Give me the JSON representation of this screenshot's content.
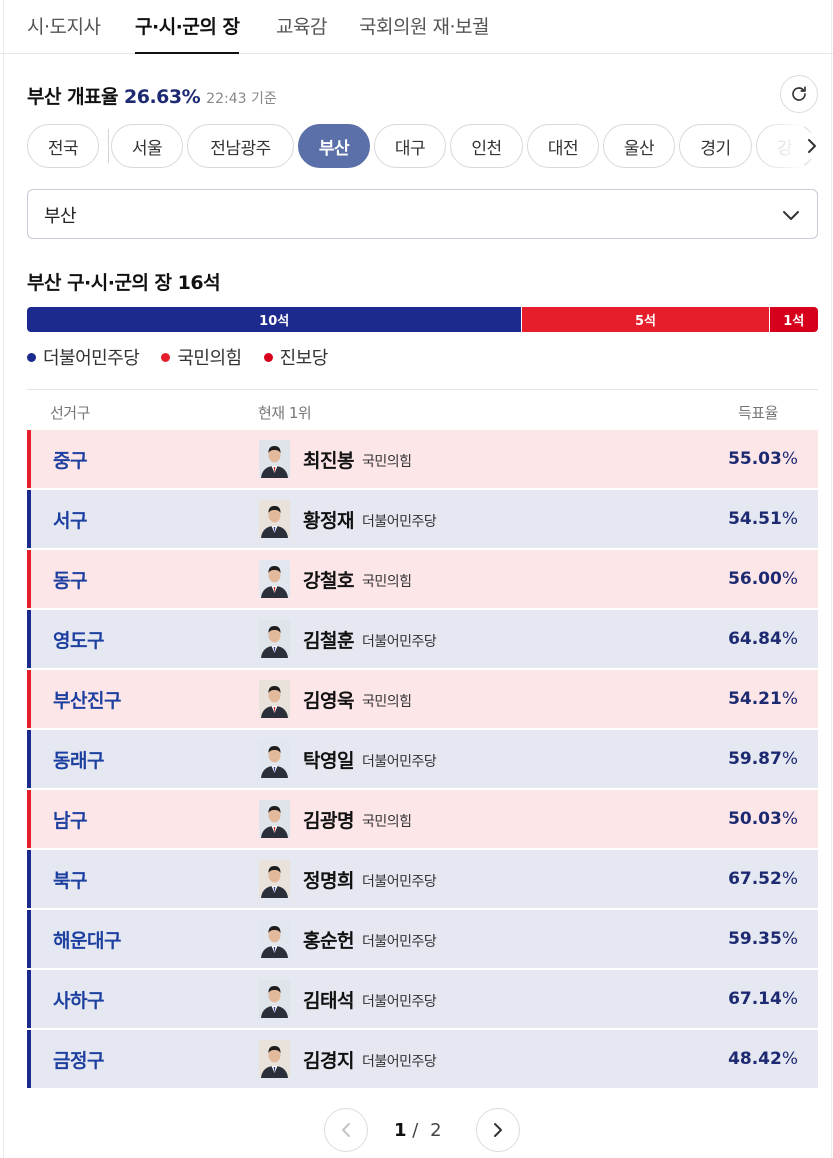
{
  "tabs": [
    {
      "label": "시·도지사",
      "active": false
    },
    {
      "label": "구·시·군의 장",
      "active": true
    },
    {
      "label": "교육감",
      "active": false
    },
    {
      "label": "국회의원 재·보궐",
      "active": false
    }
  ],
  "header": {
    "title": "부산 개표율",
    "rate": "26.63%",
    "time": "22:43 기준"
  },
  "regions": [
    {
      "label": "전국",
      "active": false
    },
    {
      "label": "서울",
      "active": false
    },
    {
      "label": "전남광주",
      "active": false
    },
    {
      "label": "부산",
      "active": true
    },
    {
      "label": "대구",
      "active": false
    },
    {
      "label": "인천",
      "active": false
    },
    {
      "label": "대전",
      "active": false
    },
    {
      "label": "울산",
      "active": false
    },
    {
      "label": "경기",
      "active": false
    },
    {
      "label": "강",
      "active": false
    }
  ],
  "select": {
    "value": "부산"
  },
  "seats": {
    "title": "부산 구·시·군의 장 16석",
    "segments": [
      {
        "label": "10석",
        "seats": 10,
        "party": "더불어민주당",
        "color": "#1b2a8c"
      },
      {
        "label": "5석",
        "seats": 5,
        "party": "국민의힘",
        "color": "#e61e2b"
      },
      {
        "label": "1석",
        "seats": 1,
        "party": "진보당",
        "color": "#d6001c"
      }
    ]
  },
  "legend": [
    {
      "label": "더불어민주당",
      "color": "#1b2a8c"
    },
    {
      "label": "국민의힘",
      "color": "#e61e2b"
    },
    {
      "label": "진보당",
      "color": "#d6001c"
    }
  ],
  "table": {
    "headers": {
      "district": "선거구",
      "leader": "현재 1위",
      "rate": "득표율"
    },
    "rows": [
      {
        "district": "중구",
        "name": "최진봉",
        "party": "국민의힘",
        "rate": "55.03",
        "side": "ppp"
      },
      {
        "district": "서구",
        "name": "황정재",
        "party": "더불어민주당",
        "rate": "54.51",
        "side": "dem"
      },
      {
        "district": "동구",
        "name": "강철호",
        "party": "국민의힘",
        "rate": "56.00",
        "side": "ppp"
      },
      {
        "district": "영도구",
        "name": "김철훈",
        "party": "더불어민주당",
        "rate": "64.84",
        "side": "dem"
      },
      {
        "district": "부산진구",
        "name": "김영욱",
        "party": "국민의힘",
        "rate": "54.21",
        "side": "ppp"
      },
      {
        "district": "동래구",
        "name": "탁영일",
        "party": "더불어민주당",
        "rate": "59.87",
        "side": "dem"
      },
      {
        "district": "남구",
        "name": "김광명",
        "party": "국민의힘",
        "rate": "50.03",
        "side": "ppp"
      },
      {
        "district": "북구",
        "name": "정명희",
        "party": "더불어민주당",
        "rate": "67.52",
        "side": "dem"
      },
      {
        "district": "해운대구",
        "name": "홍순헌",
        "party": "더불어민주당",
        "rate": "59.35",
        "side": "dem"
      },
      {
        "district": "사하구",
        "name": "김태석",
        "party": "더불어민주당",
        "rate": "67.14",
        "side": "dem"
      },
      {
        "district": "금정구",
        "name": "김경지",
        "party": "더불어민주당",
        "rate": "48.42",
        "side": "dem"
      }
    ],
    "percent_sign": "%"
  },
  "pagination": {
    "current": "1",
    "separator": "/",
    "total": "2"
  },
  "colors": {
    "dem_row_bg": "#e5e7f1",
    "dem_accent": "#1b2a8c",
    "dem_text": "#1d3fa0",
    "ppp_row_bg": "#fce6e8",
    "ppp_accent": "#e61e2b",
    "ppp_text": "#1d3fa0",
    "active_chip": "#5b6fa8"
  }
}
